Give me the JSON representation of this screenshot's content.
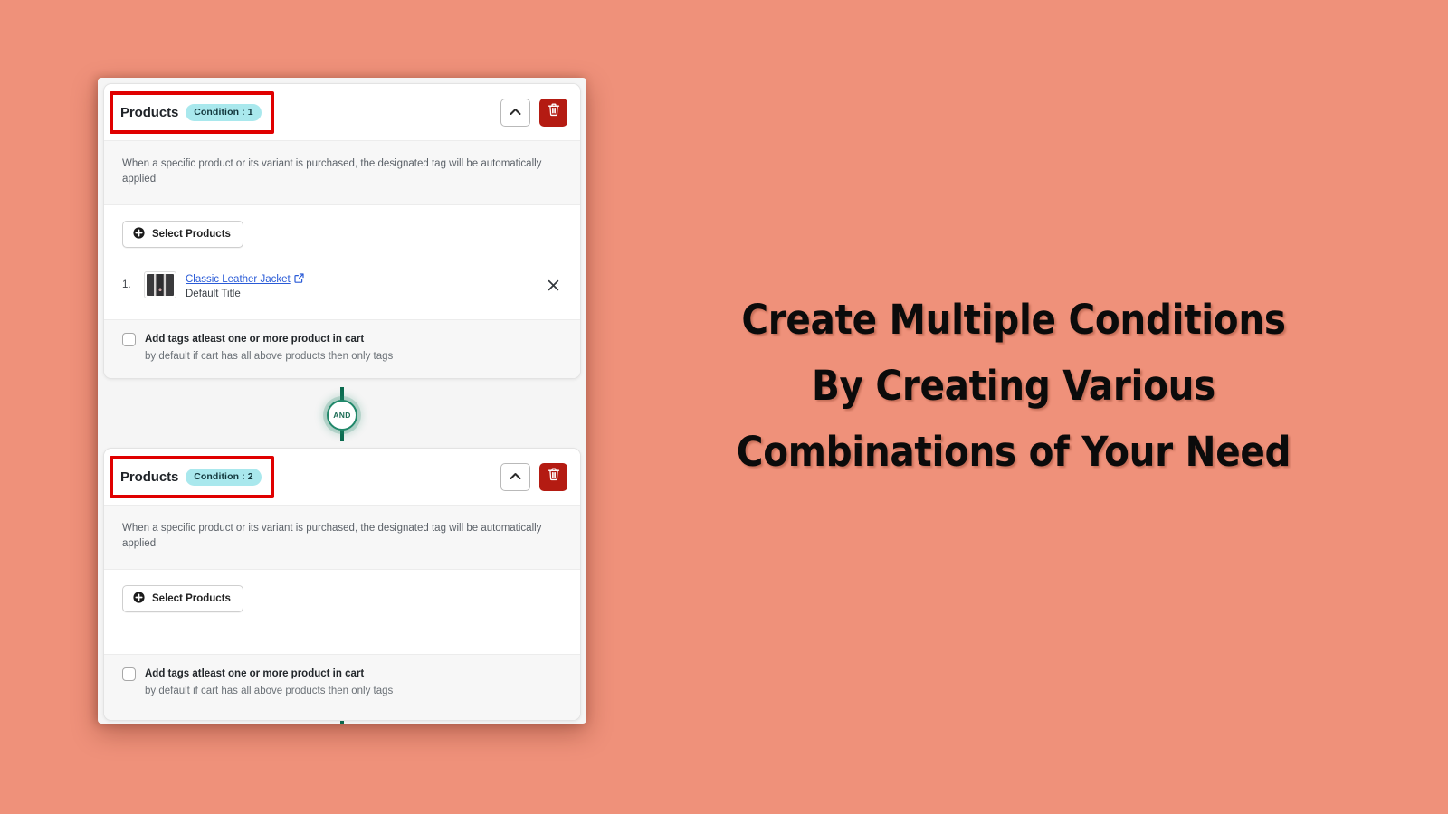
{
  "theme": {
    "background_color": "#ef917a",
    "badge_color": "#a9e8ed",
    "delete_button_color": "#b41b12",
    "annotation_color": "#e00000",
    "connector_color": "#0b6b4f",
    "and_ring_color": "#21886a",
    "link_color": "#2a5bd7"
  },
  "headline": {
    "lines": [
      "Create Multiple Conditions",
      "By Creating Various",
      "Combinations of Your Need"
    ]
  },
  "connector": {
    "label": "AND"
  },
  "conditions": [
    {
      "title": "Products",
      "badge": "Condition : 1",
      "collapse_icon": "chevron-up-icon",
      "delete_icon": "trash-icon",
      "description": "When a specific product or its variant is purchased, the designated tag will be automatically applied",
      "select_button": "Select Products",
      "select_icon": "plus-circle-icon",
      "products": [
        {
          "index": "1.",
          "name": "Classic Leather Jacket",
          "external_icon": "external-link-icon",
          "variant": "Default Title",
          "remove_icon": "close-icon",
          "thumbnail": "product-thumbnail"
        }
      ],
      "checkbox": {
        "label": "Add tags atleast one or more product in cart",
        "sublabel": "by default if cart has all above products then only tags",
        "checked": false
      }
    },
    {
      "title": "Products",
      "badge": "Condition : 2",
      "collapse_icon": "chevron-up-icon",
      "delete_icon": "trash-icon",
      "description": "When a specific product or its variant is purchased, the designated tag will be automatically applied",
      "select_button": "Select Products",
      "select_icon": "plus-circle-icon",
      "products": [],
      "checkbox": {
        "label": "Add tags atleast one or more product in cart",
        "sublabel": "by default if cart has all above products then only tags",
        "checked": false
      }
    }
  ]
}
